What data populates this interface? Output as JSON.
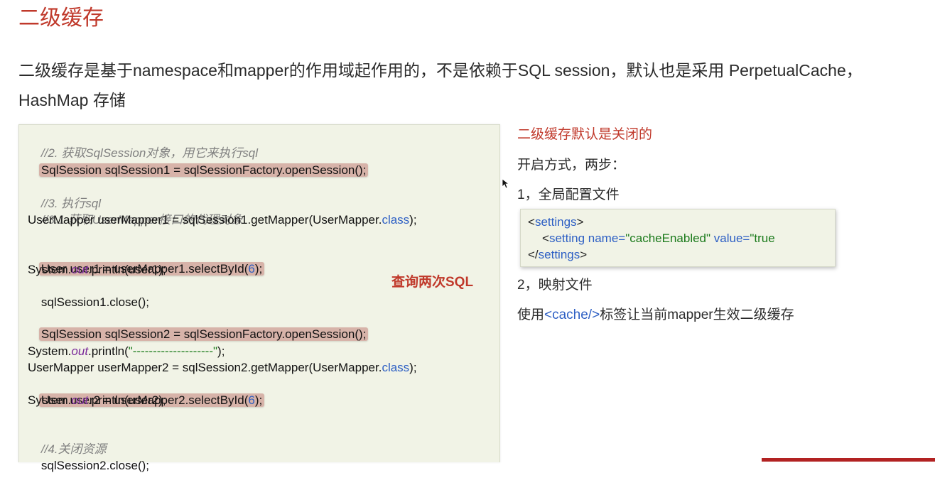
{
  "title": "二级缓存",
  "intro": "二级缓存是基于namespace和mapper的作用域起作用的，不是依赖于SQL session，默认也是采用 PerpetualCache，HashMap 存储",
  "code": {
    "c1": "//2. 获取SqlSession对象，用它来执行sql",
    "l1": "SqlSession sqlSession1 = sqlSessionFactory.openSession();",
    "c2": "//3. 执行sql",
    "c3": "//3.1 获取UserMapper接口的代理对象",
    "l2a": "UserMapper userMapper1 = sqlSession1.getMapper(UserMapper.",
    "l2b": "class",
    "l2c": ");",
    "l3a": "User user1 = userMapper1.selectById(",
    "l3b": "6",
    "l3c": ");",
    "l4a": "System.",
    "l4b": "out",
    "l4c": ".println(user1);",
    "l5": "sqlSession1.close();",
    "l6": "SqlSession sqlSession2 = sqlSessionFactory.openSession();",
    "l7a": "System.",
    "l7b": "out",
    "l7c": ".println(",
    "l7d": "\"--------------------\"",
    "l7e": ");",
    "l8a": "UserMapper userMapper2 = sqlSession2.getMapper(UserMapper.",
    "l8b": "class",
    "l8c": ");",
    "l9a": "User user2 = userMapper2.selectById(",
    "l9b": "6",
    "l9c": ");",
    "l10a": "System.",
    "l10b": "out",
    "l10c": ".println(user2);",
    "c4": "//4.关闭资源",
    "l11": "sqlSession2.close();"
  },
  "query_label": "查询两次SQL",
  "right": {
    "default_off": "二级缓存默认是关闭的",
    "enable_method": "开启方式，两步：",
    "step1": "1，全局配置文件",
    "step2": "2，映射文件",
    "usage_prefix": "使用",
    "usage_tag": "<cache/>",
    "usage_suffix": "标签让当前mapper生效二级缓存"
  },
  "xml": {
    "open_lt": "<",
    "open_name": "settings",
    "open_gt": ">",
    "setting_lt": "<",
    "setting_name": "setting",
    "attr1": " name=",
    "val1": "\"cacheEnabled\"",
    "attr2": " value=",
    "val2": "\"true",
    "close_lt": "</",
    "close_name": "settings",
    "close_gt": ">"
  },
  "colors": {
    "accent": "#c0392b",
    "highlight": "#d7b3a9",
    "code_bg": "#f1f3e6",
    "keyword": "#2d5fc4"
  }
}
